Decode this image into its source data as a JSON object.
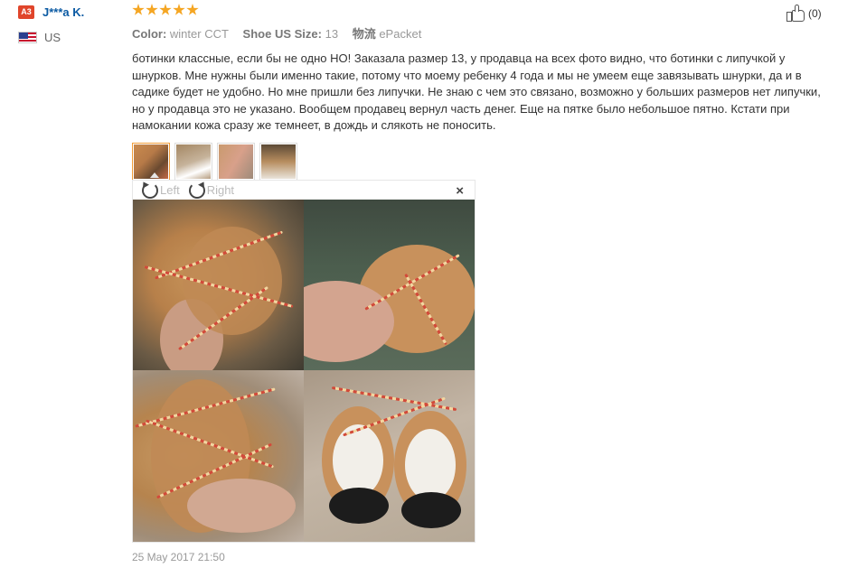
{
  "user": {
    "level_badge": "A3",
    "name": "J***a K.",
    "country": "US",
    "flag_icon": "us-flag-icon"
  },
  "rating": {
    "stars": 5,
    "max": 5,
    "color": "#f5a623"
  },
  "attributes": {
    "color_label": "Color:",
    "color_value": "winter CCT",
    "size_label": "Shoe US Size:",
    "size_value": "13",
    "shipping_label": "物流",
    "shipping_value": "ePacket"
  },
  "review_text": "ботинки классные, если бы не одно НО! Заказала размер 13, у продавца на всех фото видно, что ботинки с липучкой у шнурков. Мне нужны были именно такие, потому что моему ребенку 4 года и мы не умеем еще завязывать шнурки, да и в садике будет не удобно. Но мне пришли без липучки. Не знаю с чем это связано, возможно у больших размеров нет липучки, но у продавца это не указано. Вообщем продавец вернул часть денег. Еще на пятке было небольшое пятно. Кстати при намокании кожа сразу же темнеет, в дождь и слякоть не поносить.",
  "thumbnails": [
    {
      "name": "review-photo-1",
      "active": true
    },
    {
      "name": "review-photo-2",
      "active": false
    },
    {
      "name": "review-photo-3",
      "active": false
    },
    {
      "name": "review-photo-4",
      "active": false
    }
  ],
  "viewer": {
    "rotate_left_label": "Left",
    "rotate_right_label": "Right",
    "close_symbol": "×"
  },
  "date": "25 May 2017 21:50",
  "helpful": {
    "count": "(0)",
    "icon": "thumbs-up-icon"
  },
  "colors": {
    "accent": "#f29d38",
    "username": "#0b5aa3",
    "badge": "#e0452b"
  }
}
